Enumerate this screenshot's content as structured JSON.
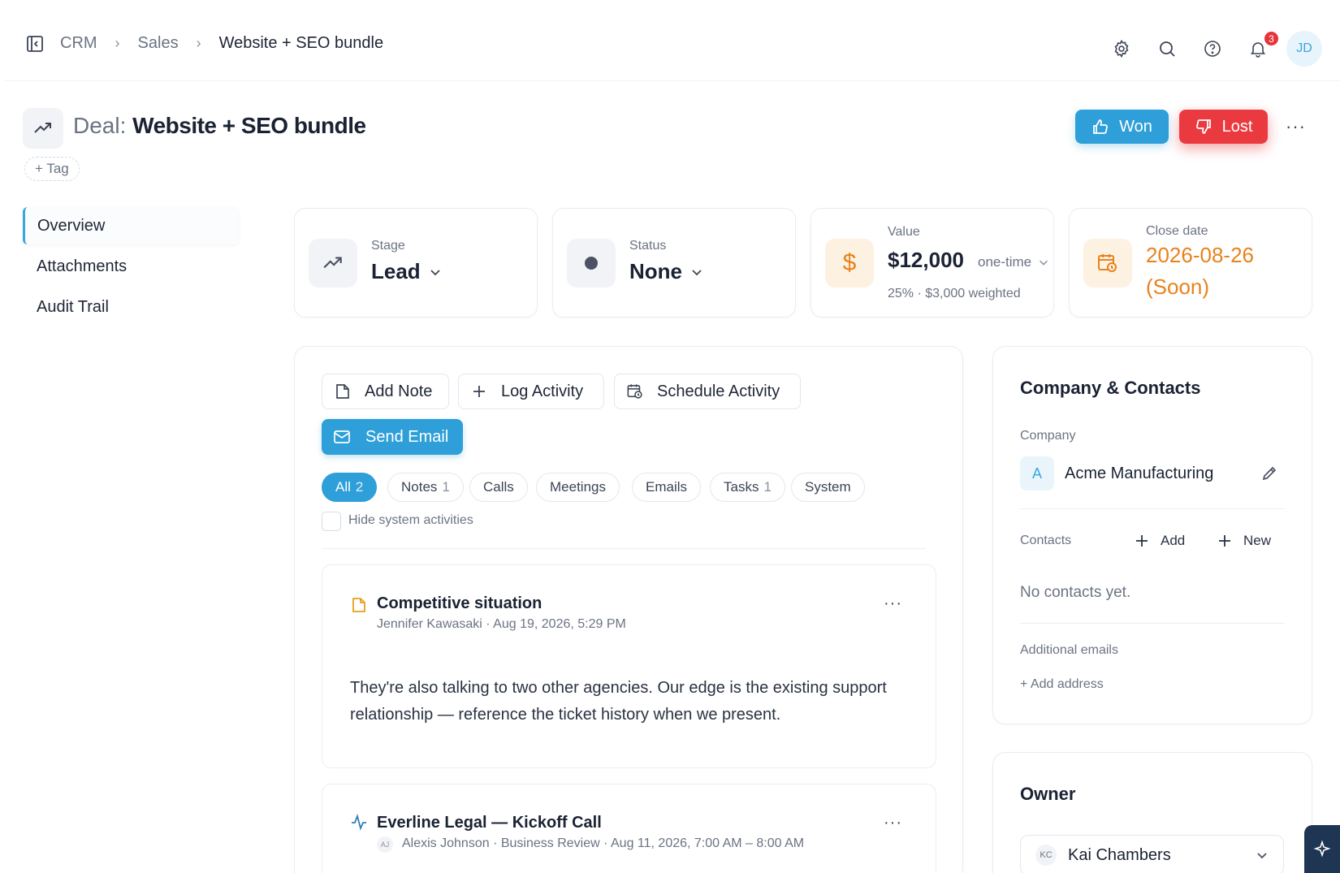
{
  "breadcrumb": {
    "items": [
      "CRM",
      "Sales",
      "Website + SEO bundle"
    ]
  },
  "header": {
    "notifications_count": "3",
    "avatar_initials": "JD"
  },
  "deal": {
    "prefix": "Deal:",
    "name": "Website + SEO bundle",
    "tag_label": "+ Tag",
    "won_label": "Won",
    "lost_label": "Lost",
    "more_label": "···"
  },
  "nav": {
    "items": [
      {
        "label": "Overview",
        "active": true
      },
      {
        "label": "Attachments",
        "active": false
      },
      {
        "label": "Audit Trail",
        "active": false
      }
    ]
  },
  "stats": {
    "stage": {
      "label": "Stage",
      "value": "Lead"
    },
    "status": {
      "label": "Status",
      "value": "None"
    },
    "value": {
      "label": "Value",
      "amount": "$12,000",
      "frequency": "one-time",
      "sub": "25% · $3,000 weighted"
    },
    "close_date": {
      "label": "Close date",
      "line1": "2026-08-26",
      "line2": "(Soon)"
    }
  },
  "activity": {
    "buttons": {
      "add_note": "Add Note",
      "log_activity": "Log Activity",
      "schedule_activity": "Schedule Activity",
      "send_email": "Send Email"
    },
    "filters": [
      {
        "label": "All",
        "count": "2",
        "active": true
      },
      {
        "label": "Notes",
        "count": "1",
        "active": false
      },
      {
        "label": "Calls",
        "count": "",
        "active": false
      },
      {
        "label": "Meetings",
        "count": "",
        "active": false
      },
      {
        "label": "Emails",
        "count": "",
        "active": false
      },
      {
        "label": "Tasks",
        "count": "1",
        "active": false
      },
      {
        "label": "System",
        "count": "",
        "active": false
      }
    ],
    "hide_system_label": "Hide system activities",
    "items": [
      {
        "title": "Competitive situation",
        "meta": "Jennifer Kawasaki · Aug 19, 2026, 5:29 PM",
        "body_line1": "They're also talking to two other agencies. Our edge is the existing support",
        "body_line2": "relationship — reference the ticket history when we present."
      },
      {
        "title": "Everline Legal — Kickoff Call",
        "initials": "AJ",
        "meta": "Alexis Johnson · Business Review · Aug 11, 2026, 7:00 AM – 8:00 AM"
      }
    ]
  },
  "company_contacts": {
    "title": "Company & Contacts",
    "company_label": "Company",
    "company_initial": "A",
    "company_name": "Acme Manufacturing",
    "contacts_label": "Contacts",
    "add_label": "Add",
    "new_label": "New",
    "empty_contacts": "No contacts yet.",
    "additional_emails_label": "Additional emails",
    "add_address_label": "+ Add address"
  },
  "owner": {
    "title": "Owner",
    "initials": "KC",
    "name": "Kai Chambers"
  },
  "colors": {
    "accent": "#2e9fd8",
    "danger": "#ea3a3f",
    "warning": "#e8821c",
    "text": "#1a2233",
    "muted": "#6b7383"
  }
}
